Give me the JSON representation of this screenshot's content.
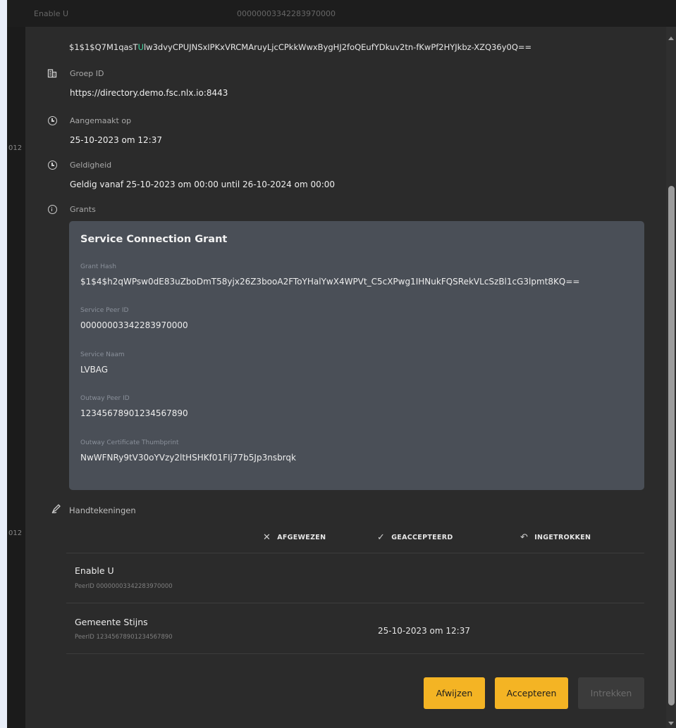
{
  "background": {
    "topbar_name": "Enable U",
    "topbar_peer": "00000003342283970000",
    "side_num": "012"
  },
  "modal": {
    "hash_prefix": "$1$1$Q7M1qasT",
    "hash_highlight": "U",
    "hash_rest": "lw3dvyCPUJNSxIPKxVRCMAruyLjcCPkkWwxBygHJ2foQEufYDkuv2tn-fKwPf2HYJkbz-XZQ36y0Q==",
    "fields": {
      "group": {
        "label": "Groep ID",
        "value": "https://directory.demo.fsc.nlx.io:8443",
        "icon": "building-icon"
      },
      "created": {
        "label": "Aangemaakt op",
        "value": "25-10-2023 om 12:37",
        "icon": "clock-icon"
      },
      "validity": {
        "label": "Geldigheid",
        "value": "Geldig vanaf 25-10-2023 om 00:00 until 26-10-2024 om 00:00",
        "icon": "clock-icon"
      },
      "grants": {
        "label": "Grants",
        "icon": "info-icon"
      }
    },
    "grant": {
      "title": "Service Connection Grant",
      "hash_label": "Grant Hash",
      "hash_value": "$1$4$h2qWPsw0dE83uZboDmT58yjx26Z3booA2FToYHalYwX4WPVt_C5cXPwg1IHNukFQSRekVLcSzBl1cG3lpmt8KQ==",
      "service_peer_label": "Service Peer ID",
      "service_peer_value": "00000003342283970000",
      "service_name_label": "Service Naam",
      "service_name_value": "LVBAG",
      "outway_peer_label": "Outway Peer ID",
      "outway_peer_value": "12345678901234567890",
      "outway_cert_label": "Outway Certificate Thumbprint",
      "outway_cert_value": "NwWFNRy9tV30oYVzy2ltHSHKf01FIj77b5Jp3nsbrqk"
    },
    "signatures": {
      "label": "Handtekeningen",
      "headers": {
        "rejected": "AFGEWEZEN",
        "accepted": "GEACCEPTEERD",
        "revoked": "INGETROKKEN"
      },
      "rows": [
        {
          "name": "Enable U",
          "peer": "PeerID 00000003342283970000",
          "accepted_date": ""
        },
        {
          "name": "Gemeente Stijns",
          "peer": "PeerID 12345678901234567890",
          "accepted_date": "25-10-2023 om 12:37"
        }
      ]
    },
    "buttons": {
      "reject": "Afwijzen",
      "accept": "Accepteren",
      "revoke": "Intrekken"
    },
    "colors": {
      "accent": "#f4b424",
      "hash_highlight": "#44d7a2",
      "card": "#4a4f57"
    }
  }
}
